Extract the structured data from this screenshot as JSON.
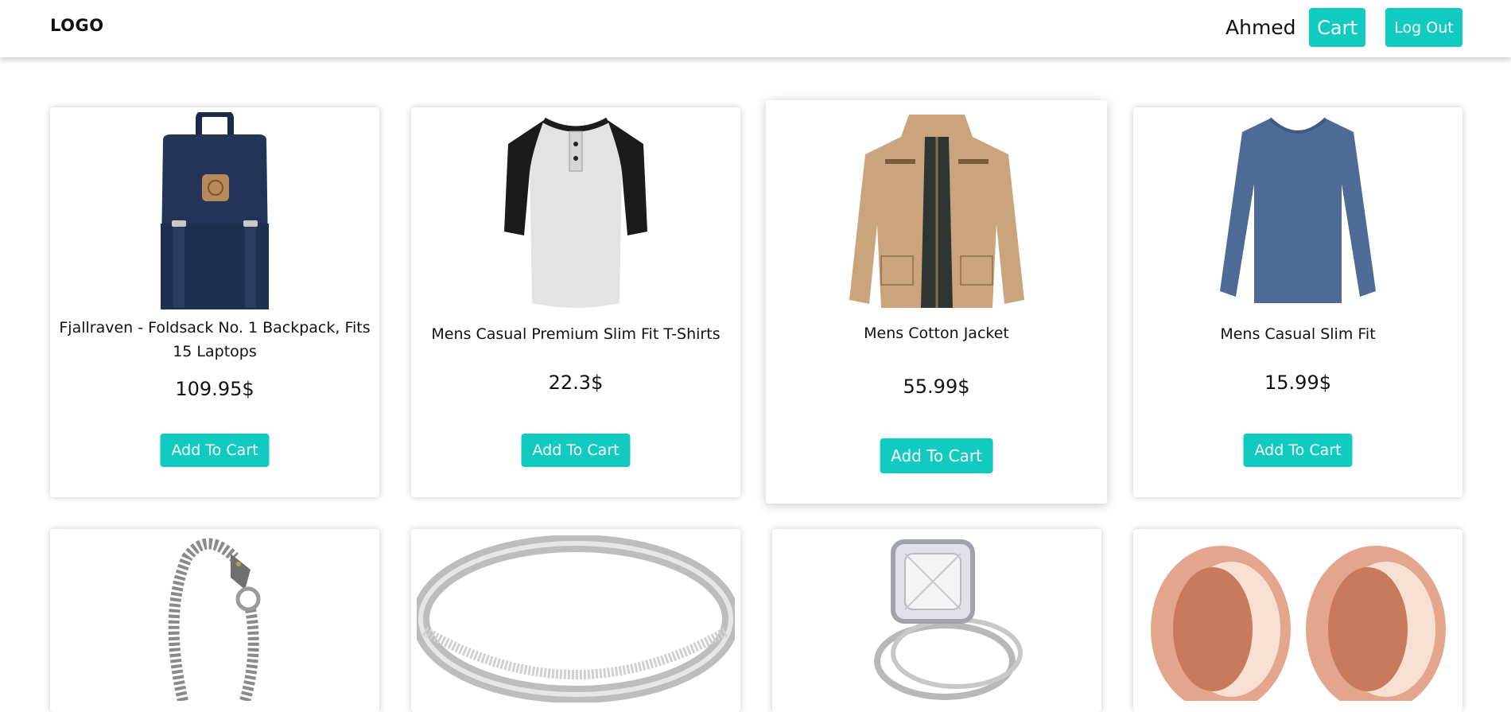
{
  "header": {
    "logo": "LOGO",
    "user_name": "Ahmed",
    "cart_label": "Cart",
    "logout_label": "Log Out"
  },
  "products": [
    {
      "title": "Fjallraven - Foldsack No. 1 Backpack, Fits 15 Laptops",
      "price": "109.95$",
      "button": "Add To Cart",
      "icon": "backpack"
    },
    {
      "title": "Mens Casual Premium Slim Fit T-Shirts",
      "price": "22.3$",
      "button": "Add To Cart",
      "icon": "raglan-tshirt"
    },
    {
      "title": "Mens Cotton Jacket",
      "price": "55.99$",
      "button": "Add To Cart",
      "icon": "jacket"
    },
    {
      "title": "Mens Casual Slim Fit",
      "price": "15.99$",
      "button": "Add To Cart",
      "icon": "long-sleeve-shirt"
    },
    {
      "icon": "dragon-bracelet"
    },
    {
      "icon": "silver-ring"
    },
    {
      "icon": "diamond-ring-set"
    },
    {
      "icon": "rose-gold-tunnels"
    }
  ],
  "colors": {
    "accent": "#11cbc0",
    "backpack": "#1f2f4f",
    "jacket": "#c9a47c",
    "shirt": "#4d6b96",
    "rose_gold": "#d58a6c"
  }
}
